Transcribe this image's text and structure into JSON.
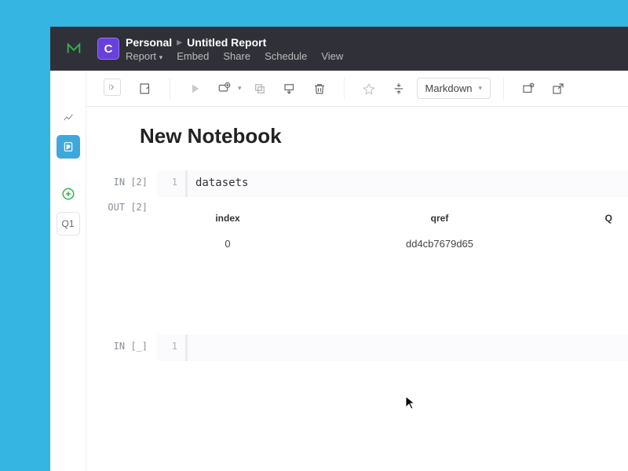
{
  "header": {
    "workspace_badge": "C",
    "workspace": "Personal",
    "title": "Untitled Report",
    "menus": {
      "report": "Report",
      "embed": "Embed",
      "share": "Share",
      "schedule": "Schedule",
      "view": "View"
    }
  },
  "toolbar": {
    "format": "Markdown"
  },
  "rail": {
    "q1": "Q1"
  },
  "notebook": {
    "title": "New Notebook",
    "cells": {
      "in2_prompt": "IN [2]",
      "in2_ln": "1",
      "in2_code": "datasets",
      "out2_prompt": "OUT [2]",
      "table": {
        "col1": "index",
        "col2": "qref",
        "col3_partial": "Q",
        "row1_c1": "0",
        "row1_c2": "dd4cb7679d65"
      },
      "in_blank_prompt": "IN [_]",
      "in_blank_ln": "1",
      "in_blank_code": ""
    }
  }
}
